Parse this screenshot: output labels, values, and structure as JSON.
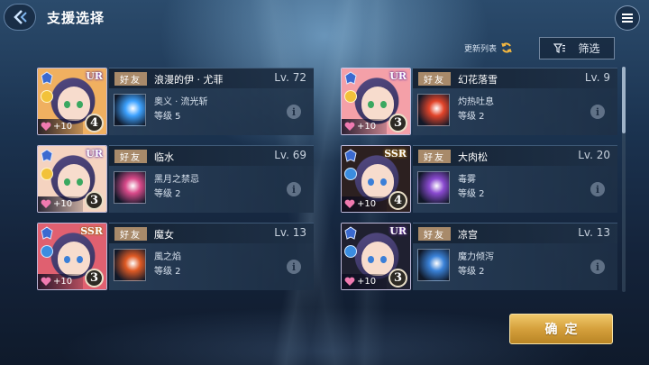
{
  "header": {
    "title": "支援选择",
    "back_icon": "back-arrow-icon",
    "menu_icon": "hamburger-menu-icon"
  },
  "toolbar": {
    "refresh_label": "更新列表",
    "refresh_icon": "refresh-icon",
    "filter_label": "筛选",
    "filter_icon": "filter-icon"
  },
  "supports": [
    {
      "tag": "好友",
      "name": "浪漫的伊 · 尤菲",
      "level": "Lv. 72",
      "rarity": "UR",
      "element": "gold",
      "bond": "+10",
      "stars": "4",
      "skill_name": "奥义 · 流光斩",
      "skill_level": "等级 5",
      "skill_color": "#3da2ff",
      "hair_color": "#f0b060"
    },
    {
      "tag": "好友",
      "name": "幻花落雪",
      "level": "Lv.  9",
      "rarity": "UR",
      "element": "gold",
      "bond": "+10",
      "stars": "3",
      "skill_name": "灼热吐息",
      "skill_level": "等级 2",
      "skill_color": "#e2442a",
      "hair_color": "#f4a0a8"
    },
    {
      "tag": "好友",
      "name": "临水",
      "level": "Lv. 69",
      "rarity": "UR",
      "element": "gold",
      "bond": "+10",
      "stars": "3",
      "skill_name": "黑月之禁忌",
      "skill_level": "等级 2",
      "skill_color": "#d94a8a",
      "hair_color": "#f5d3c0"
    },
    {
      "tag": "好友",
      "name": "大肉松",
      "level": "Lv. 20",
      "rarity": "SSR",
      "element": "blue",
      "bond": "+10",
      "stars": "4",
      "skill_name": "毒雾",
      "skill_level": "等级 2",
      "skill_color": "#8a4ad0",
      "hair_color": "#2c2020"
    },
    {
      "tag": "好友",
      "name": "魔女",
      "level": "Lv. 13",
      "rarity": "SSR",
      "element": "blue",
      "bond": "+10",
      "stars": "3",
      "skill_name": "風之焰",
      "skill_level": "等级 2",
      "skill_color": "#e05a24",
      "hair_color": "#e06070"
    },
    {
      "tag": "好友",
      "name": "凉宫",
      "level": "Lv. 13",
      "rarity": "UR",
      "element": "blue",
      "bond": "+10",
      "stars": "3",
      "skill_name": "魔力倾泻",
      "skill_level": "等级 2",
      "skill_color": "#3a82d8",
      "hair_color": "#1f2030"
    }
  ],
  "info_icon": "info-icon",
  "confirm_label": "确定"
}
